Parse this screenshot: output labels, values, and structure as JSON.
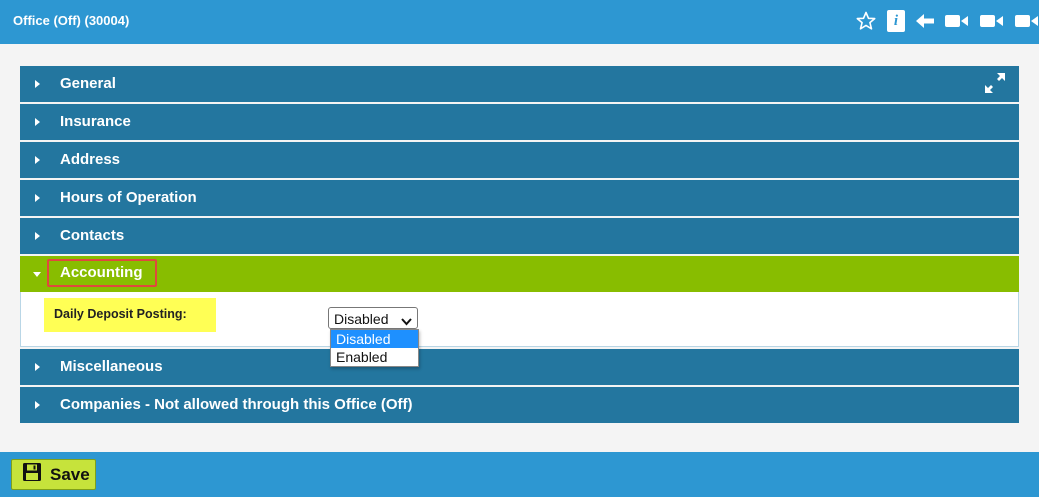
{
  "window": {
    "title": "Office (Off) (30004)"
  },
  "toolbar_icons": [
    "star-icon",
    "info-icon",
    "back-arrow-icon",
    "video-icon",
    "video-icon",
    "video-icon"
  ],
  "info_glyph": "i",
  "sections": [
    {
      "label": "General"
    },
    {
      "label": "Insurance"
    },
    {
      "label": "Address"
    },
    {
      "label": "Hours of Operation"
    },
    {
      "label": "Contacts"
    },
    {
      "label": "Accounting",
      "expanded": true
    },
    {
      "label": "Miscellaneous"
    },
    {
      "label": "Companies - Not allowed through this Office (Off)"
    }
  ],
  "accounting": {
    "field_label": "Daily Deposit Posting:",
    "selected": "Disabled",
    "options": [
      "Disabled",
      "Enabled"
    ]
  },
  "footer": {
    "save_label": "Save"
  },
  "colors": {
    "header_bg": "#2d97d2",
    "section_bg": "#23769f",
    "active_section_bg": "#88bd00",
    "highlight_label_bg": "#ffff55",
    "save_button_bg": "#c6e33b",
    "selected_option_bg": "#1e90ff",
    "focus_outline": "#e0483d"
  }
}
